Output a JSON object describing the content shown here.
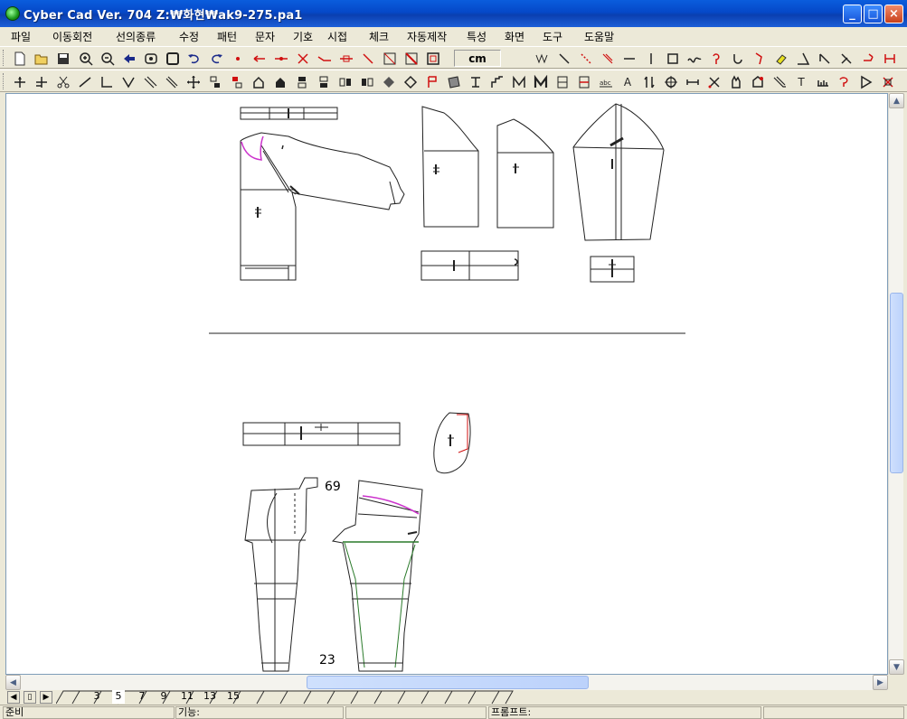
{
  "window": {
    "title": "Cyber Cad Ver. 704  Z:₩화현₩ak9-275.pa1",
    "minimize_label": "_",
    "maximize_label": "□",
    "close_label": "×"
  },
  "menu": {
    "items": [
      "파일",
      "이동회전",
      "선의종류",
      "수정",
      "패턴",
      "문자",
      "기호",
      "시접",
      "체크",
      "자동제작",
      "특성",
      "화면",
      "도구",
      "도움말"
    ]
  },
  "toolbar": {
    "unit_label": "cm",
    "text_tool_label": "T",
    "text_tool2_label": "A"
  },
  "canvas": {
    "label_69": "69",
    "label_23": "23"
  },
  "pages": {
    "tabs": [
      "3",
      "5",
      "7",
      "9",
      "11",
      "13",
      "15"
    ],
    "active": "5"
  },
  "status": {
    "ready": "준비",
    "function_label": "기능:",
    "prompt_label": "프롬프트:"
  },
  "colors": {
    "titlebar": "#0548c8",
    "accent_magenta": "#cc33cc",
    "accent_green": "#2a7a2a"
  }
}
